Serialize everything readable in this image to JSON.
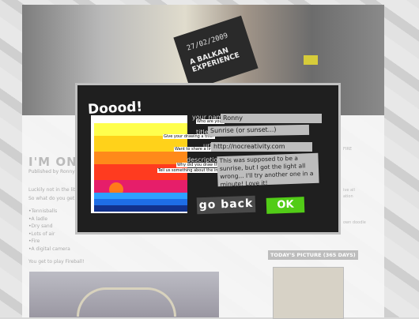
{
  "banner": {
    "sign_date": "27/02/2009",
    "sign_text": "A BALKAN EXPERIENCE"
  },
  "blog": {
    "title": "I'M ON FI",
    "meta": "Published by Ronny on 31",
    "p1": "Luckily not in the lite",
    "p2": "So what do you get w",
    "list": [
      "Tennisballs",
      "A ladle",
      "Dry sand",
      "Lots of air",
      "Fire",
      "A digital camera"
    ],
    "p3": "You get to play Fireball!"
  },
  "sidebar": {
    "heading": "TODAY'S PICTURE (365 DAYS)",
    "faint_1": "FIRE",
    "faint_2": "ive all",
    "faint_3": "ation",
    "faint_4": "own doodle"
  },
  "dialog": {
    "logo_text": "Doood!",
    "name_label": "your name",
    "name_hint": "Who are you?",
    "name_value": "Ronny",
    "title_label": "title",
    "title_hint": "Give your drawing a title!",
    "title_value": "Sunrise (or sunset...)",
    "url_label": "url",
    "url_hint": "Want to share a link?",
    "url_value": "http://nocreativity.com",
    "description_label": "description",
    "description_hint_1": "Why did you draw this?",
    "description_hint_2": "Tell us something about the image.",
    "description_value": "This was supposed to be a sunrise, but I got the light all wrong... I'll try another one in a minute! Love it!",
    "back_button": "go back",
    "ok_button": "OK"
  },
  "colors": {
    "ok_green": "#52cc17",
    "dialog_bg": "#1f1f1f"
  }
}
